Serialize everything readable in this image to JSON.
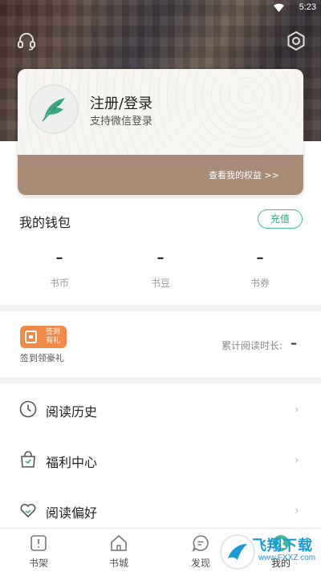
{
  "status_bar": {
    "time": "5:23"
  },
  "header": {
    "headset_icon": "headset-icon",
    "settings_icon": "settings-icon"
  },
  "member_card": {
    "title": "注册/登录",
    "subtitle": "支持微信登录",
    "benefits_link": "查看我的权益 >>",
    "accent": "#a78c78"
  },
  "wallet": {
    "title": "我的钱包",
    "recharge_label": "充值",
    "accent": "#3dbb9b",
    "stats": [
      {
        "value": "–",
        "label": "书币"
      },
      {
        "value": "–",
        "label": "书豆"
      },
      {
        "value": "–",
        "label": "书券"
      }
    ]
  },
  "signin": {
    "badge_text": "签到有礼",
    "caption": "签到领豪礼",
    "reading_time_label": "累计阅读时长:",
    "reading_time_value": "–",
    "badge_color": "#f08a4b"
  },
  "menu": [
    {
      "label": "阅读历史",
      "icon": "clock-icon",
      "chevron": "›"
    },
    {
      "label": "福利中心",
      "icon": "gift-bag-icon",
      "chevron": "›"
    },
    {
      "label": "阅读偏好",
      "icon": "heart-icon",
      "chevron": "›"
    }
  ],
  "bottom_nav": [
    {
      "label": "书架",
      "icon": "bookshelf-icon"
    },
    {
      "label": "书城",
      "icon": "bookstore-icon"
    },
    {
      "label": "发现",
      "icon": "discover-icon"
    },
    {
      "label": "我的",
      "icon": "profile-icon"
    }
  ],
  "watermark": {
    "title": "飞翔下载",
    "url": "www.FXXZ.com"
  }
}
